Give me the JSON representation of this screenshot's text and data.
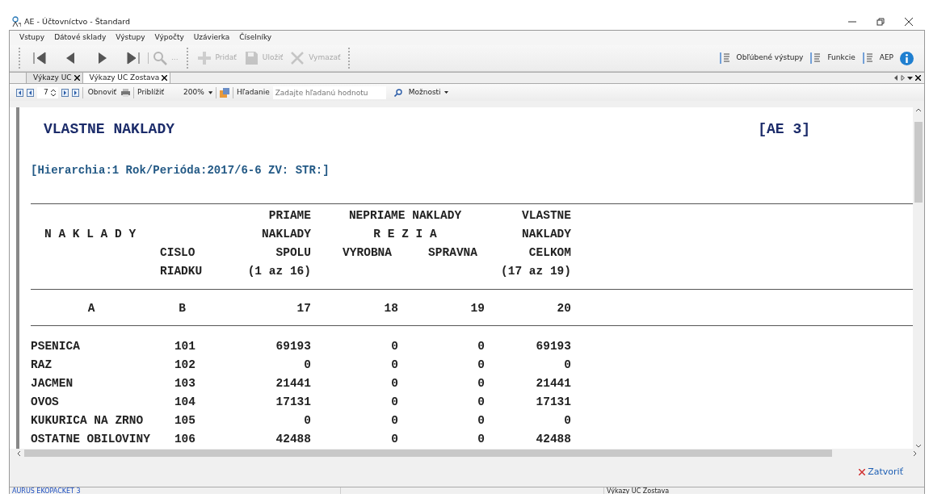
{
  "window": {
    "title": "AE - Účtovníctvo - Štandard"
  },
  "menu": [
    "Vstupy",
    "Dátové sklady",
    "Výstupy",
    "Výpočty",
    "Uzávierka",
    "Číselníky"
  ],
  "toolbar": [
    {
      "kind": "first",
      "disabled": false
    },
    {
      "kind": "prev",
      "disabled": false
    },
    {
      "kind": "next",
      "disabled": false
    },
    {
      "kind": "last",
      "disabled": false
    },
    {
      "kind": "search",
      "label": "...",
      "disabled": true
    },
    {
      "kind": "add",
      "label": "Pridať",
      "disabled": true
    },
    {
      "kind": "save",
      "label": "Uložiť",
      "disabled": true
    },
    {
      "kind": "delete",
      "label": "Vymazať",
      "disabled": true
    }
  ],
  "toolbar_right": [
    {
      "kind": "list",
      "label": "Obľúbené výstupy"
    },
    {
      "kind": "list",
      "label": "Funkcie"
    },
    {
      "kind": "list",
      "label": "AEP"
    },
    {
      "kind": "info"
    }
  ],
  "tabs": [
    {
      "label": "Výkazy UC",
      "selected": false
    },
    {
      "label": "Výkazy UC Zostava",
      "selected": true
    }
  ],
  "report_toolbar": {
    "page": "7",
    "refresh": "Obnoviť",
    "zoom_label": "Priblížiť",
    "zoom": "200%",
    "search_label": "Hľadanie",
    "search_placeholder": "Zadajte hľadanú hodnotu",
    "options": "Možnosti"
  },
  "report": {
    "title": "VLASTNE NAKLADY",
    "code": "[AE 3]",
    "params": "[Hierarchia:1 Rok/Perióda:2017/6-6 ZV: STR:]",
    "header_rows": [
      {
        "c17": "PRIAME",
        "c18_19": "NEPRIAME NAKLADY",
        "c20": "VLASTNE"
      },
      {
        "a": "N A K L A D Y",
        "c17": "NAKLADY",
        "c18_19": "R E Z I A",
        "c20": "NAKLADY"
      },
      {
        "b": "CISLO",
        "c17": "SPOLU",
        "c18": "VYROBNA",
        "c19": "SPRAVNA",
        "c20": "CELKOM"
      },
      {
        "b": "RIADKU",
        "c17": "(1 az 16)",
        "c20": "(17 az 19)"
      }
    ],
    "letters": [
      "A",
      "B",
      "17",
      "18",
      "19",
      "20"
    ],
    "rows": [
      [
        "PSENICA",
        "101",
        "69193",
        "0",
        "0",
        "69193"
      ],
      [
        "RAZ",
        "102",
        "0",
        "0",
        "0",
        "0"
      ],
      [
        "JACMEN",
        "103",
        "21441",
        "0",
        "0",
        "21441"
      ],
      [
        "OVOS",
        "104",
        "17131",
        "0",
        "0",
        "17131"
      ],
      [
        "KUKURICA NA ZRNO",
        "105",
        "0",
        "0",
        "0",
        "0"
      ],
      [
        "OSTATNE OBILOVINY",
        "106",
        "42488",
        "0",
        "0",
        "42488"
      ]
    ]
  },
  "close_button": "Zatvoriť",
  "status_bar": [
    "AURUS EKOPACKET 3",
    "Výkazy UC Zostava"
  ]
}
